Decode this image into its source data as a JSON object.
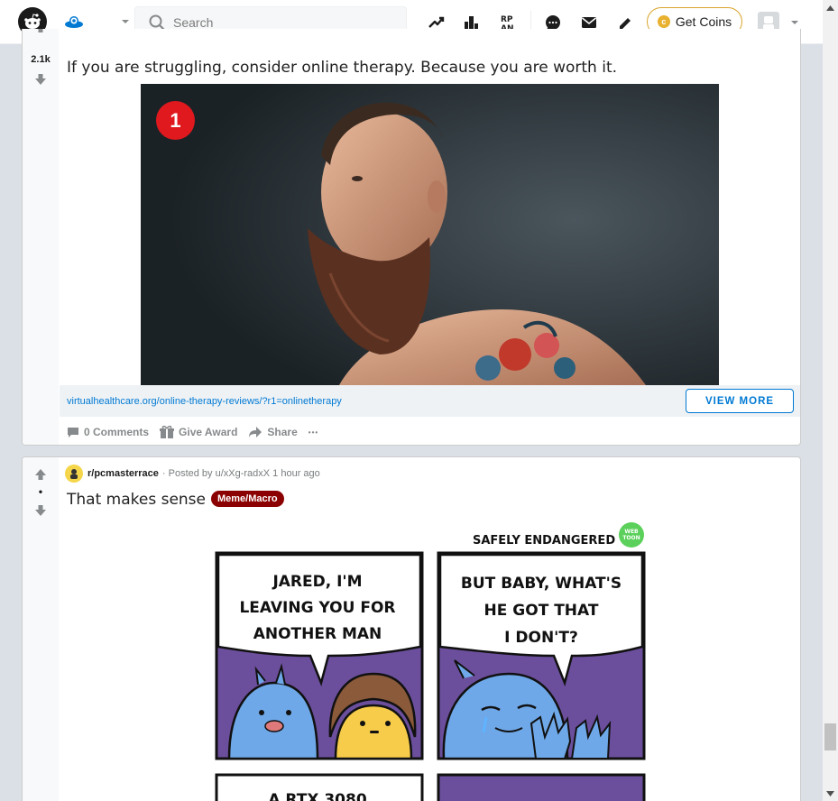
{
  "header": {
    "search_placeholder": "Search",
    "coins_label": "Get Coins",
    "coin_glyph": "c"
  },
  "post1": {
    "score": "2.1k",
    "title": "If you are struggling, consider online therapy. Because you are worth it.",
    "badge_number": "1",
    "link_url": "virtualhealthcare.org/online-therapy-reviews/?r1=onlinetherapy",
    "view_more_label": "VIEW MORE",
    "actions": {
      "comments": "0 Comments",
      "award": "Give Award",
      "share": "Share",
      "more": "•••"
    }
  },
  "post2": {
    "score": "•",
    "subreddit": "r/pcmasterrace",
    "posted_by": "· Posted by u/xXg-radxX 1 hour ago",
    "title": "That makes sense",
    "flair": "Meme/Macro",
    "comic": {
      "header": "SAFELY ENDANGERED",
      "webtoon_badge": "WEB TOON",
      "panel1_lines": [
        "JARED, I'M",
        "LEAVING YOU FOR",
        "ANOTHER MAN"
      ],
      "panel2_lines": [
        "BUT BABY, WHAT'S",
        "HE GOT THAT",
        "I DON'T?"
      ],
      "panel3_partial": "A RTX 3080"
    }
  },
  "colors": {
    "accent_blue": "#0079d3",
    "flair_red": "#8b0000",
    "badge_red": "#e0191e",
    "comic_purple": "#6b4f9c"
  }
}
